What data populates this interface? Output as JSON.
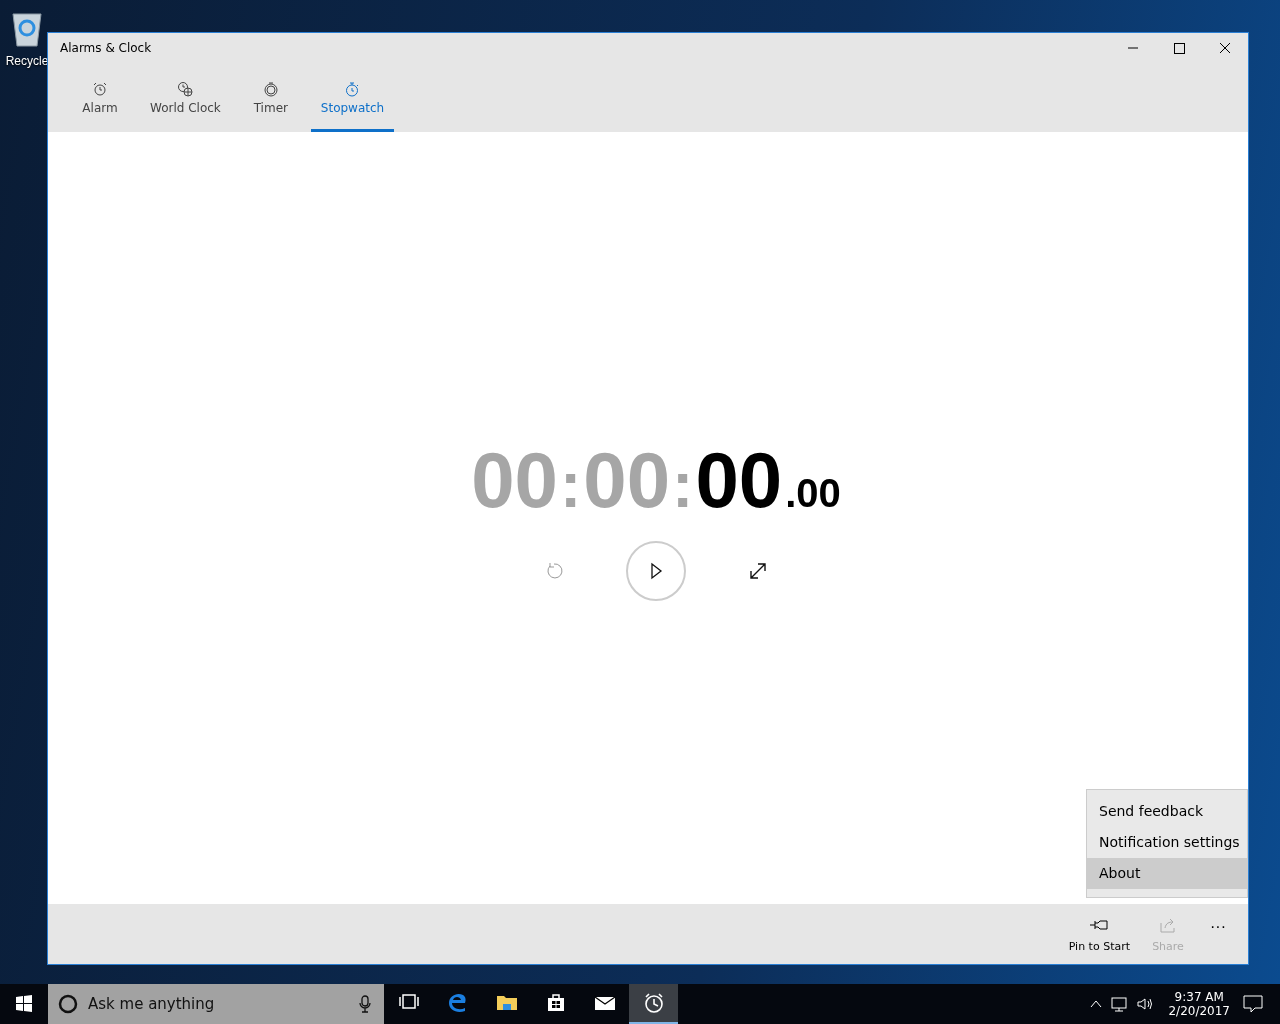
{
  "desktop_icons": [
    {
      "label": "Recycle",
      "kind": "recycle"
    }
  ],
  "window": {
    "title": "Alarms & Clock"
  },
  "tabs": [
    {
      "label": "Alarm",
      "kind": "alarm",
      "selected": false
    },
    {
      "label": "World Clock",
      "kind": "world",
      "selected": false
    },
    {
      "label": "Timer",
      "kind": "timer",
      "selected": false
    },
    {
      "label": "Stopwatch",
      "kind": "stopwatch",
      "selected": true
    }
  ],
  "stopwatch": {
    "parts": [
      {
        "text": "00",
        "kind": "dim"
      },
      {
        "text": ":",
        "kind": "dimsep"
      },
      {
        "text": "00",
        "kind": "dim"
      },
      {
        "text": ":",
        "kind": "dimsep"
      },
      {
        "text": "00",
        "kind": "main"
      },
      {
        "text": ".00",
        "kind": "small"
      }
    ],
    "controls": [
      {
        "kind": "reset",
        "disabled": true
      },
      {
        "kind": "play",
        "disabled": false
      },
      {
        "kind": "expand",
        "disabled": false
      }
    ]
  },
  "menu": {
    "items": [
      {
        "label": "Send feedback",
        "selected": false
      },
      {
        "label": "Notification settings",
        "selected": false
      },
      {
        "label": "About",
        "selected": true
      }
    ]
  },
  "command_bar": {
    "buttons": [
      {
        "label": "Pin to Start",
        "kind": "pin",
        "disabled": false
      },
      {
        "label": "Share",
        "kind": "share",
        "disabled": true
      }
    ],
    "more": "···"
  },
  "taskbar": {
    "search_placeholder": "Ask me anything",
    "apps": [
      {
        "kind": "taskview",
        "selected": false
      },
      {
        "kind": "edge",
        "selected": false
      },
      {
        "kind": "explorer",
        "selected": false
      },
      {
        "kind": "store",
        "selected": false
      },
      {
        "kind": "mail",
        "selected": false
      },
      {
        "kind": "alarms",
        "selected": true
      }
    ],
    "time": "9:37 AM",
    "date": "2/20/2017"
  }
}
